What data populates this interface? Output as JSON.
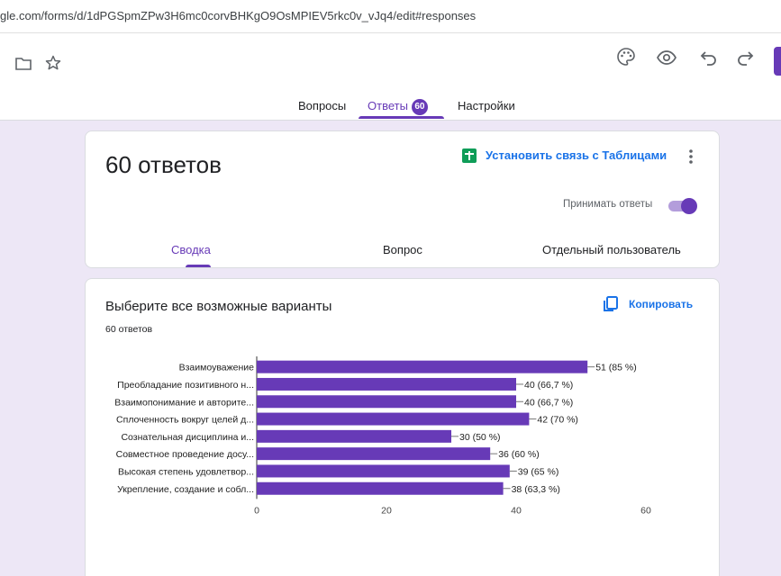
{
  "browser": {
    "url": "gle.com/forms/d/1dPGSpmZPw3H6mc0corvBHKgO9OsMPIEV5rkc0v_vJq4/edit#responses"
  },
  "toolbar": {
    "icons": [
      "folder-icon",
      "star-icon",
      "palette-icon",
      "preview-eye-icon",
      "undo-icon",
      "redo-icon"
    ],
    "tabs": {
      "questions": "Вопросы",
      "responses": "Ответы",
      "responses_badge": "60",
      "settings": "Настройки"
    }
  },
  "summary_card": {
    "count_title": "60 ответов",
    "sheets_link": "Установить связь с Таблицами",
    "accept_label": "Принимать ответы",
    "accept_enabled": true,
    "subtabs": {
      "summary": "Сводка",
      "question": "Вопрос",
      "individual": "Отдельный пользователь"
    }
  },
  "question_card": {
    "title": "Выберите все возможные варианты",
    "response_count": "60 ответов",
    "copy_label": "Копировать"
  },
  "colors": {
    "accent": "#673ab7",
    "link": "#1a73e8",
    "background": "#ede7f6"
  },
  "chart_data": {
    "type": "bar",
    "orientation": "horizontal",
    "categories": [
      "Взаимоуважение",
      "Преобладание позитивного н...",
      "Взаимопонимание и авторите...",
      "Сплоченность вокруг целей д...",
      "Сознательная дисциплина и...",
      "Совместное проведение досу...",
      "Высокая степень удовлетвор...",
      "Укрепление, создание и собл..."
    ],
    "values": [
      51,
      40,
      40,
      42,
      30,
      36,
      39,
      38
    ],
    "data_labels": [
      "51 (85 %)",
      "40 (66,7 %)",
      "40 (66,7 %)",
      "42 (70 %)",
      "30 (50 %)",
      "36 (60 %)",
      "39 (65 %)",
      "38 (63,3 %)"
    ],
    "x_ticks": [
      0,
      20,
      40,
      60
    ],
    "xlim": [
      0,
      60
    ],
    "bar_color": "#673ab7",
    "grid": false
  }
}
